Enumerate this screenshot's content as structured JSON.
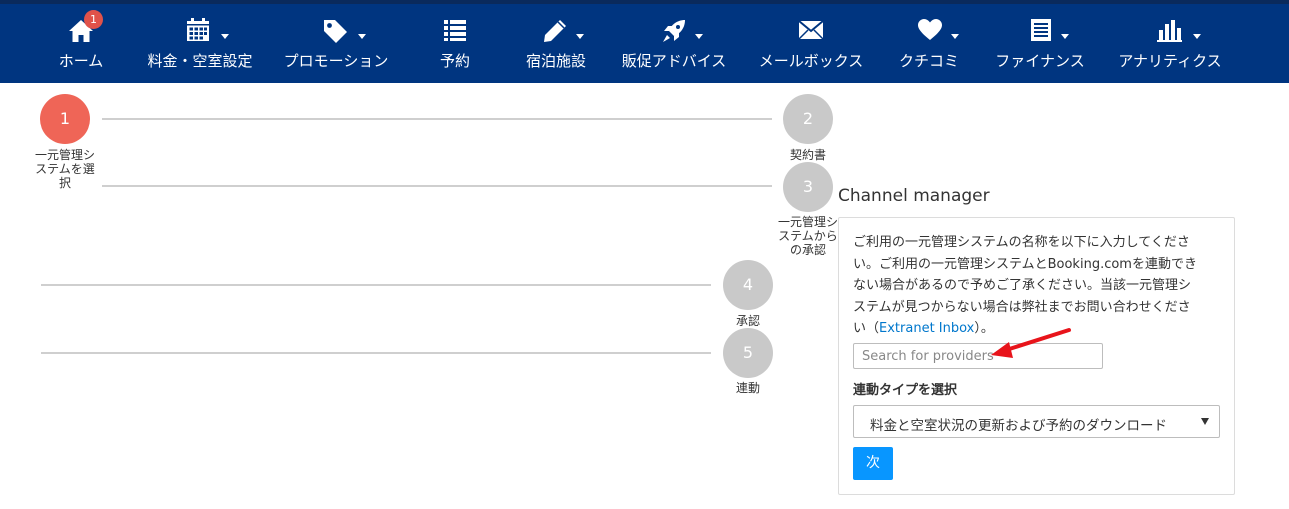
{
  "nav": {
    "badge_count": "1",
    "items": [
      {
        "label": "ホーム",
        "icon": "home-icon"
      },
      {
        "label": "料金・空室設定",
        "icon": "calendar-icon"
      },
      {
        "label": "プロモーション",
        "icon": "tag-icon"
      },
      {
        "label": "予約",
        "icon": "list-icon"
      },
      {
        "label": "宿泊施設",
        "icon": "pencil-icon"
      },
      {
        "label": "販促アドバイス",
        "icon": "rocket-icon"
      },
      {
        "label": "メールボックス",
        "icon": "envelope-icon"
      },
      {
        "label": "クチコミ",
        "icon": "heart-icon"
      },
      {
        "label": "ファイナンス",
        "icon": "document-icon"
      },
      {
        "label": "アナリティクス",
        "icon": "bar-chart-icon"
      }
    ]
  },
  "steps": [
    {
      "number": "1",
      "label": "一元管理システムを選択",
      "active": true
    },
    {
      "number": "2",
      "label": "契約書",
      "active": false
    },
    {
      "number": "3",
      "label": "一元管理システムからの承認",
      "active": false
    },
    {
      "number": "4",
      "label": "承認",
      "active": false
    },
    {
      "number": "5",
      "label": "連動",
      "active": false
    }
  ],
  "panel": {
    "title": "Channel manager",
    "description_lines": [
      "ご利用の一元管理システムの名称を以下に入力してくださ",
      "い。ご利用の一元管理システムとBooking.comを連動でき",
      "ない場合があるので予めご了承ください。当該一元管理シ",
      "ステムが見つからない場合は弊社までお問い合わせくださ"
    ],
    "description_last_prefix": "い（",
    "inbox_link": "Extranet Inbox",
    "description_last_suffix": "）。",
    "search_placeholder": "Search for providers",
    "select_label": "連動タイプを選択",
    "select_value": "料金と空室状況の更新および予約のダウンロード",
    "next_label": "次"
  },
  "colors": {
    "nav_background": "#003580",
    "active_step": "#ef6557",
    "inactive_step": "#c9c9c9",
    "next_button": "#0896ff",
    "annotation_arrow": "#e8141b"
  }
}
